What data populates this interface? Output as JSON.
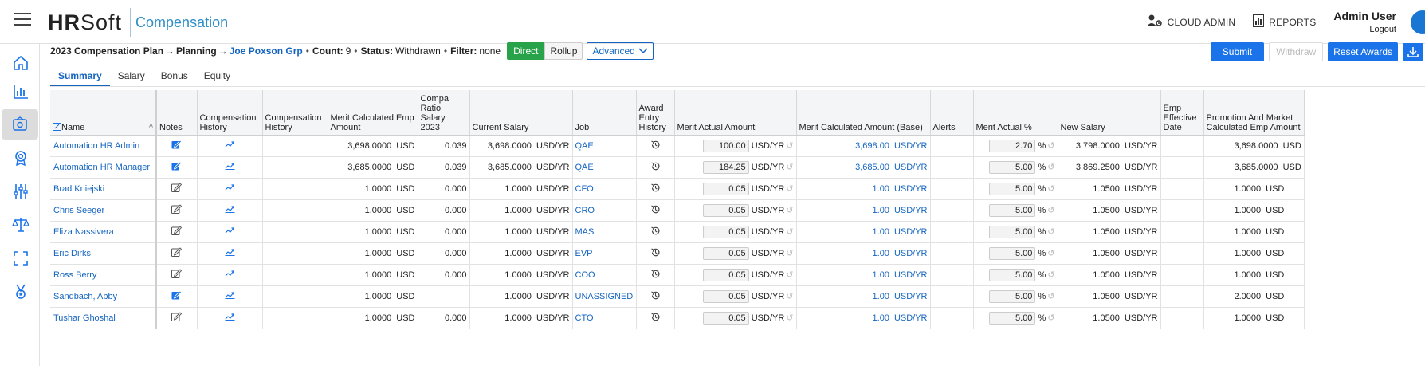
{
  "header": {
    "logo_hr": "HR",
    "logo_soft": "Soft",
    "product": "Compensation",
    "cloud_admin": "CLOUD ADMIN",
    "reports": "REPORTS",
    "user_name": "Admin User",
    "logout": "Logout"
  },
  "toolbar": {
    "plan": "2023 Compensation Plan",
    "arrow": "→",
    "planning": "Planning",
    "group": "Joe Poxson Grp",
    "count_label": "Count:",
    "count": "9",
    "status_label": "Status:",
    "status": "Withdrawn",
    "filter_label": "Filter:",
    "filter": "none",
    "direct": "Direct",
    "rollup": "Rollup",
    "advanced": "Advanced",
    "submit": "Submit",
    "withdraw": "Withdraw",
    "reset": "Reset Awards"
  },
  "tabs": [
    "Summary",
    "Salary",
    "Bonus",
    "Equity"
  ],
  "columns": {
    "name": "Name",
    "notes": "Notes",
    "comp_hist1": "Compensation History",
    "comp_hist2": "Compensation History",
    "merit_calc_emp": "Merit Calculated Emp Amount",
    "compa": "Compa Ratio Salary 2023",
    "current_salary": "Current Salary",
    "job": "Job",
    "award_hist": "Award Entry History",
    "merit_actual": "Merit Actual Amount",
    "merit_calc_base": "Merit Calculated Amount (Base)",
    "alerts": "Alerts",
    "merit_actual_pct": "Merit Actual %",
    "new_salary": "New Salary",
    "emp_eff_date": "Emp Effective Date",
    "promo": "Promotion And Market Calculated Emp Amount"
  },
  "rows": [
    {
      "name": "Automation HR Admin",
      "note_active": true,
      "merit_calc": "3,698.0000",
      "merit_unit": "USD",
      "compa": "0.039",
      "salary": "3,698.0000",
      "salary_unit": "USD/YR",
      "job": "QAE",
      "merit_actual": "100.00",
      "ma_unit": "USD/YR",
      "base": "3,698.00",
      "base_unit": "USD/YR",
      "pct": "2.70",
      "pct_unit": "%",
      "new_salary": "3,798.0000",
      "ns_unit": "USD/YR",
      "promo": "3,698.0000",
      "promo_unit": "USD"
    },
    {
      "name": "Automation HR Manager",
      "note_active": true,
      "merit_calc": "3,685.0000",
      "merit_unit": "USD",
      "compa": "0.039",
      "salary": "3,685.0000",
      "salary_unit": "USD/YR",
      "job": "QAE",
      "merit_actual": "184.25",
      "ma_unit": "USD/YR",
      "base": "3,685.00",
      "base_unit": "USD/YR",
      "pct": "5.00",
      "pct_unit": "%",
      "new_salary": "3,869.2500",
      "ns_unit": "USD/YR",
      "promo": "3,685.0000",
      "promo_unit": "USD"
    },
    {
      "name": "Brad Kniejski",
      "note_active": false,
      "merit_calc": "1.0000",
      "merit_unit": "USD",
      "compa": "0.000",
      "salary": "1.0000",
      "salary_unit": "USD/YR",
      "job": "CFO",
      "merit_actual": "0.05",
      "ma_unit": "USD/YR",
      "base": "1.00",
      "base_unit": "USD/YR",
      "pct": "5.00",
      "pct_unit": "%",
      "new_salary": "1.0500",
      "ns_unit": "USD/YR",
      "promo": "1.0000",
      "promo_unit": "USD"
    },
    {
      "name": "Chris Seeger",
      "note_active": false,
      "merit_calc": "1.0000",
      "merit_unit": "USD",
      "compa": "0.000",
      "salary": "1.0000",
      "salary_unit": "USD/YR",
      "job": "CRO",
      "merit_actual": "0.05",
      "ma_unit": "USD/YR",
      "base": "1.00",
      "base_unit": "USD/YR",
      "pct": "5.00",
      "pct_unit": "%",
      "new_salary": "1.0500",
      "ns_unit": "USD/YR",
      "promo": "1.0000",
      "promo_unit": "USD"
    },
    {
      "name": "Eliza Nassivera",
      "note_active": false,
      "merit_calc": "1.0000",
      "merit_unit": "USD",
      "compa": "0.000",
      "salary": "1.0000",
      "salary_unit": "USD/YR",
      "job": "MAS",
      "merit_actual": "0.05",
      "ma_unit": "USD/YR",
      "base": "1.00",
      "base_unit": "USD/YR",
      "pct": "5.00",
      "pct_unit": "%",
      "new_salary": "1.0500",
      "ns_unit": "USD/YR",
      "promo": "1.0000",
      "promo_unit": "USD"
    },
    {
      "name": "Eric Dirks",
      "note_active": false,
      "merit_calc": "1.0000",
      "merit_unit": "USD",
      "compa": "0.000",
      "salary": "1.0000",
      "salary_unit": "USD/YR",
      "job": "EVP",
      "merit_actual": "0.05",
      "ma_unit": "USD/YR",
      "base": "1.00",
      "base_unit": "USD/YR",
      "pct": "5.00",
      "pct_unit": "%",
      "new_salary": "1.0500",
      "ns_unit": "USD/YR",
      "promo": "1.0000",
      "promo_unit": "USD"
    },
    {
      "name": "Ross Berry",
      "note_active": false,
      "merit_calc": "1.0000",
      "merit_unit": "USD",
      "compa": "0.000",
      "salary": "1.0000",
      "salary_unit": "USD/YR",
      "job": "COO",
      "merit_actual": "0.05",
      "ma_unit": "USD/YR",
      "base": "1.00",
      "base_unit": "USD/YR",
      "pct": "5.00",
      "pct_unit": "%",
      "new_salary": "1.0500",
      "ns_unit": "USD/YR",
      "promo": "1.0000",
      "promo_unit": "USD"
    },
    {
      "name": "Sandbach, Abby",
      "note_active": true,
      "merit_calc": "1.0000",
      "merit_unit": "USD",
      "compa": "",
      "salary": "1.0000",
      "salary_unit": "USD/YR",
      "job": "UNASSIGNED",
      "merit_actual": "0.05",
      "ma_unit": "USD/YR",
      "base": "1.00",
      "base_unit": "USD/YR",
      "pct": "5.00",
      "pct_unit": "%",
      "new_salary": "1.0500",
      "ns_unit": "USD/YR",
      "promo": "2.0000",
      "promo_unit": "USD"
    },
    {
      "name": "Tushar Ghoshal",
      "note_active": false,
      "merit_calc": "1.0000",
      "merit_unit": "USD",
      "compa": "0.000",
      "salary": "1.0000",
      "salary_unit": "USD/YR",
      "job": "CTO",
      "merit_actual": "0.05",
      "ma_unit": "USD/YR",
      "base": "1.00",
      "base_unit": "USD/YR",
      "pct": "5.00",
      "pct_unit": "%",
      "new_salary": "1.0500",
      "ns_unit": "USD/YR",
      "promo": "1.0000",
      "promo_unit": "USD"
    }
  ],
  "colors": {
    "accent": "#1a73e8",
    "direct": "#29a34a",
    "link": "#1565c0"
  },
  "icons": {
    "menu": "hamburger-icon",
    "sidebar": [
      "home-icon",
      "chart-icon",
      "compensation-icon",
      "award-icon",
      "sliders-icon",
      "scale-icon",
      "expand-icon",
      "medal-icon"
    ]
  }
}
